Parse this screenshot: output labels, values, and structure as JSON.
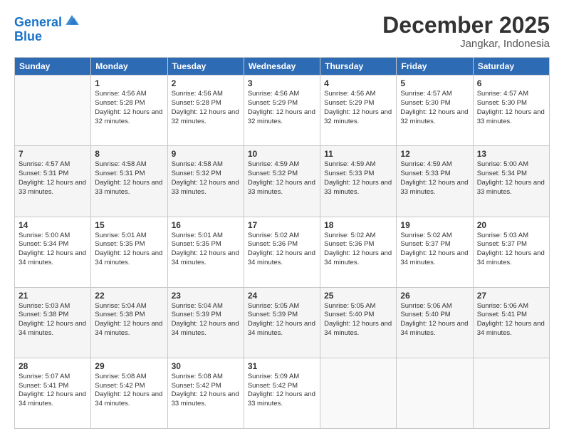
{
  "logo": {
    "line1": "General",
    "line2": "Blue"
  },
  "title": "December 2025",
  "subtitle": "Jangkar, Indonesia",
  "weekdays": [
    "Sunday",
    "Monday",
    "Tuesday",
    "Wednesday",
    "Thursday",
    "Friday",
    "Saturday"
  ],
  "weeks": [
    [
      {
        "day": "",
        "empty": true
      },
      {
        "day": "1",
        "rise": "4:56 AM",
        "set": "5:28 PM",
        "daylight": "12 hours and 32 minutes."
      },
      {
        "day": "2",
        "rise": "4:56 AM",
        "set": "5:28 PM",
        "daylight": "12 hours and 32 minutes."
      },
      {
        "day": "3",
        "rise": "4:56 AM",
        "set": "5:29 PM",
        "daylight": "12 hours and 32 minutes."
      },
      {
        "day": "4",
        "rise": "4:56 AM",
        "set": "5:29 PM",
        "daylight": "12 hours and 32 minutes."
      },
      {
        "day": "5",
        "rise": "4:57 AM",
        "set": "5:30 PM",
        "daylight": "12 hours and 32 minutes."
      },
      {
        "day": "6",
        "rise": "4:57 AM",
        "set": "5:30 PM",
        "daylight": "12 hours and 33 minutes."
      }
    ],
    [
      {
        "day": "7",
        "rise": "4:57 AM",
        "set": "5:31 PM",
        "daylight": "12 hours and 33 minutes."
      },
      {
        "day": "8",
        "rise": "4:58 AM",
        "set": "5:31 PM",
        "daylight": "12 hours and 33 minutes."
      },
      {
        "day": "9",
        "rise": "4:58 AM",
        "set": "5:32 PM",
        "daylight": "12 hours and 33 minutes."
      },
      {
        "day": "10",
        "rise": "4:59 AM",
        "set": "5:32 PM",
        "daylight": "12 hours and 33 minutes."
      },
      {
        "day": "11",
        "rise": "4:59 AM",
        "set": "5:33 PM",
        "daylight": "12 hours and 33 minutes."
      },
      {
        "day": "12",
        "rise": "4:59 AM",
        "set": "5:33 PM",
        "daylight": "12 hours and 33 minutes."
      },
      {
        "day": "13",
        "rise": "5:00 AM",
        "set": "5:34 PM",
        "daylight": "12 hours and 33 minutes."
      }
    ],
    [
      {
        "day": "14",
        "rise": "5:00 AM",
        "set": "5:34 PM",
        "daylight": "12 hours and 34 minutes."
      },
      {
        "day": "15",
        "rise": "5:01 AM",
        "set": "5:35 PM",
        "daylight": "12 hours and 34 minutes."
      },
      {
        "day": "16",
        "rise": "5:01 AM",
        "set": "5:35 PM",
        "daylight": "12 hours and 34 minutes."
      },
      {
        "day": "17",
        "rise": "5:02 AM",
        "set": "5:36 PM",
        "daylight": "12 hours and 34 minutes."
      },
      {
        "day": "18",
        "rise": "5:02 AM",
        "set": "5:36 PM",
        "daylight": "12 hours and 34 minutes."
      },
      {
        "day": "19",
        "rise": "5:02 AM",
        "set": "5:37 PM",
        "daylight": "12 hours and 34 minutes."
      },
      {
        "day": "20",
        "rise": "5:03 AM",
        "set": "5:37 PM",
        "daylight": "12 hours and 34 minutes."
      }
    ],
    [
      {
        "day": "21",
        "rise": "5:03 AM",
        "set": "5:38 PM",
        "daylight": "12 hours and 34 minutes."
      },
      {
        "day": "22",
        "rise": "5:04 AM",
        "set": "5:38 PM",
        "daylight": "12 hours and 34 minutes."
      },
      {
        "day": "23",
        "rise": "5:04 AM",
        "set": "5:39 PM",
        "daylight": "12 hours and 34 minutes."
      },
      {
        "day": "24",
        "rise": "5:05 AM",
        "set": "5:39 PM",
        "daylight": "12 hours and 34 minutes."
      },
      {
        "day": "25",
        "rise": "5:05 AM",
        "set": "5:40 PM",
        "daylight": "12 hours and 34 minutes."
      },
      {
        "day": "26",
        "rise": "5:06 AM",
        "set": "5:40 PM",
        "daylight": "12 hours and 34 minutes."
      },
      {
        "day": "27",
        "rise": "5:06 AM",
        "set": "5:41 PM",
        "daylight": "12 hours and 34 minutes."
      }
    ],
    [
      {
        "day": "28",
        "rise": "5:07 AM",
        "set": "5:41 PM",
        "daylight": "12 hours and 34 minutes."
      },
      {
        "day": "29",
        "rise": "5:08 AM",
        "set": "5:42 PM",
        "daylight": "12 hours and 34 minutes."
      },
      {
        "day": "30",
        "rise": "5:08 AM",
        "set": "5:42 PM",
        "daylight": "12 hours and 33 minutes."
      },
      {
        "day": "31",
        "rise": "5:09 AM",
        "set": "5:42 PM",
        "daylight": "12 hours and 33 minutes."
      },
      {
        "day": "",
        "empty": true
      },
      {
        "day": "",
        "empty": true
      },
      {
        "day": "",
        "empty": true
      }
    ]
  ],
  "labels": {
    "sunrise": "Sunrise:",
    "sunset": "Sunset:",
    "daylight": "Daylight:"
  }
}
